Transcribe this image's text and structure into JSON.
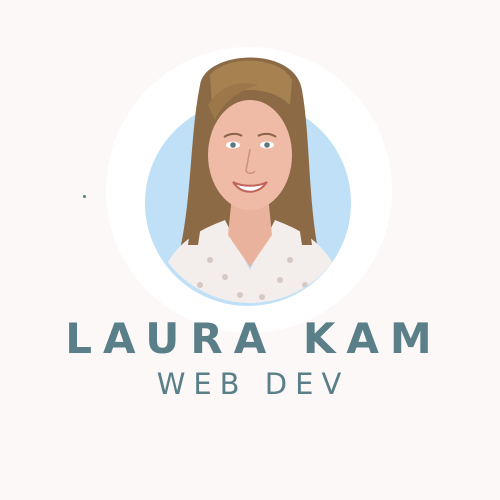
{
  "profile": {
    "name": "LAURA KAM",
    "role": "WEB DEV"
  },
  "colors": {
    "background": "#fcf8f7",
    "accent": "#5a7f89",
    "circle_bg": "#bfe0f7",
    "ring": "#ffffff"
  },
  "icons": {
    "portrait": "person-photo"
  }
}
